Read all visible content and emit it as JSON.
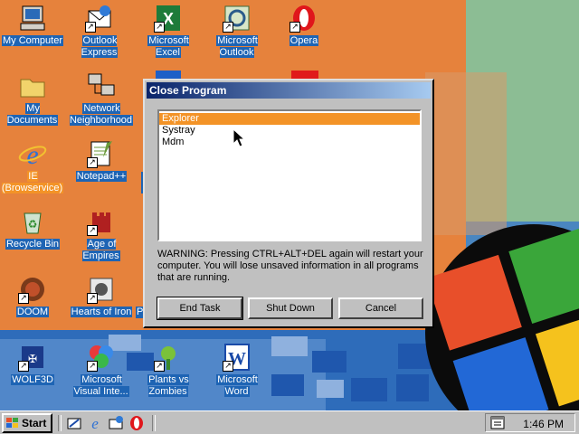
{
  "desktop_icons": [
    {
      "id": "my-computer",
      "label": "My Computer",
      "icon": "computer-icon"
    },
    {
      "id": "outlook-express",
      "label": "Outlook Express",
      "icon": "outlook-express-icon"
    },
    {
      "id": "excel",
      "label": "Microsoft Excel",
      "icon": "excel-icon"
    },
    {
      "id": "outlook",
      "label": "Microsoft Outlook",
      "icon": "outlook-icon"
    },
    {
      "id": "opera",
      "label": "Opera",
      "icon": "opera-icon"
    },
    {
      "id": "my-documents",
      "label": "My Documents",
      "icon": "folder-icon"
    },
    {
      "id": "network",
      "label": "Network Neighborhood",
      "icon": "network-icon"
    },
    {
      "id": "ie",
      "label": "IE (Browservice)",
      "icon": "ie-icon"
    },
    {
      "id": "notepadpp",
      "label": "Notepad++",
      "icon": "notepad-icon"
    },
    {
      "id": "recycle",
      "label": "Recycle Bin",
      "icon": "recycle-bin-icon"
    },
    {
      "id": "aoe",
      "label": "Age of Empires",
      "icon": "age-of-empires-icon"
    },
    {
      "id": "doom",
      "label": "DOOM",
      "icon": "doom-icon"
    },
    {
      "id": "hoi",
      "label": "Hearts of Iron",
      "icon": "hearts-of-iron-icon"
    },
    {
      "id": "wolf3d",
      "label": "WOLF3D",
      "icon": "wolf3d-icon"
    },
    {
      "id": "vi",
      "label": "Microsoft Visual Inte...",
      "icon": "visual-interdev-icon"
    },
    {
      "id": "pvz",
      "label": "Plants vs Zombies",
      "icon": "plants-vs-zombies-icon"
    },
    {
      "id": "word",
      "label": "Microsoft Word",
      "icon": "word-icon"
    },
    {
      "id": "partial-p",
      "label": "P",
      "icon": ""
    }
  ],
  "dialog": {
    "title": "Close Program",
    "programs": [
      "Explorer",
      "Systray",
      "Mdm"
    ],
    "selected": "Explorer",
    "warning": "WARNING: Pressing CTRL+ALT+DEL again will restart your computer. You will lose unsaved information in all programs that are running.",
    "buttons": {
      "end_task": "End Task",
      "shut_down": "Shut Down",
      "cancel": "Cancel"
    }
  },
  "taskbar": {
    "start_label": "Start",
    "quick_launch": [
      "show-desktop-icon",
      "ie-icon",
      "outlook-express-icon",
      "opera-icon"
    ],
    "clock": "1:46 PM",
    "tray_icon": "task-scheduler-icon"
  },
  "colors": {
    "selection": "#f39327",
    "title_start": "#0a246a",
    "title_end": "#a6caf0",
    "icon_label_bg": "#1e64b4"
  }
}
